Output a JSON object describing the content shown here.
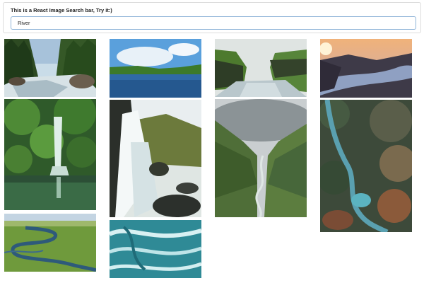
{
  "search": {
    "label": "This is a React Image Search bar, Try it:)",
    "value": "River",
    "placeholder": ""
  },
  "results": {
    "query": "River",
    "images": [
      {
        "column": 1,
        "subject": "forest river with rocks"
      },
      {
        "column": 1,
        "subject": "waterfall in green forest with pond"
      },
      {
        "column": 1,
        "subject": "aerial view of winding river in green plain"
      },
      {
        "column": 2,
        "subject": "blue lake with green shore and sky"
      },
      {
        "column": 2,
        "subject": "waterfall over dark rocks"
      },
      {
        "column": 2,
        "subject": "turquoise rushing water"
      },
      {
        "column": 3,
        "subject": "river between green rock cliffs"
      },
      {
        "column": 3,
        "subject": "misty valley with winding stream"
      },
      {
        "column": 4,
        "subject": "lake at sunset among hills"
      },
      {
        "column": 4,
        "subject": "aerial view of river through autumn forest canyon"
      }
    ]
  }
}
